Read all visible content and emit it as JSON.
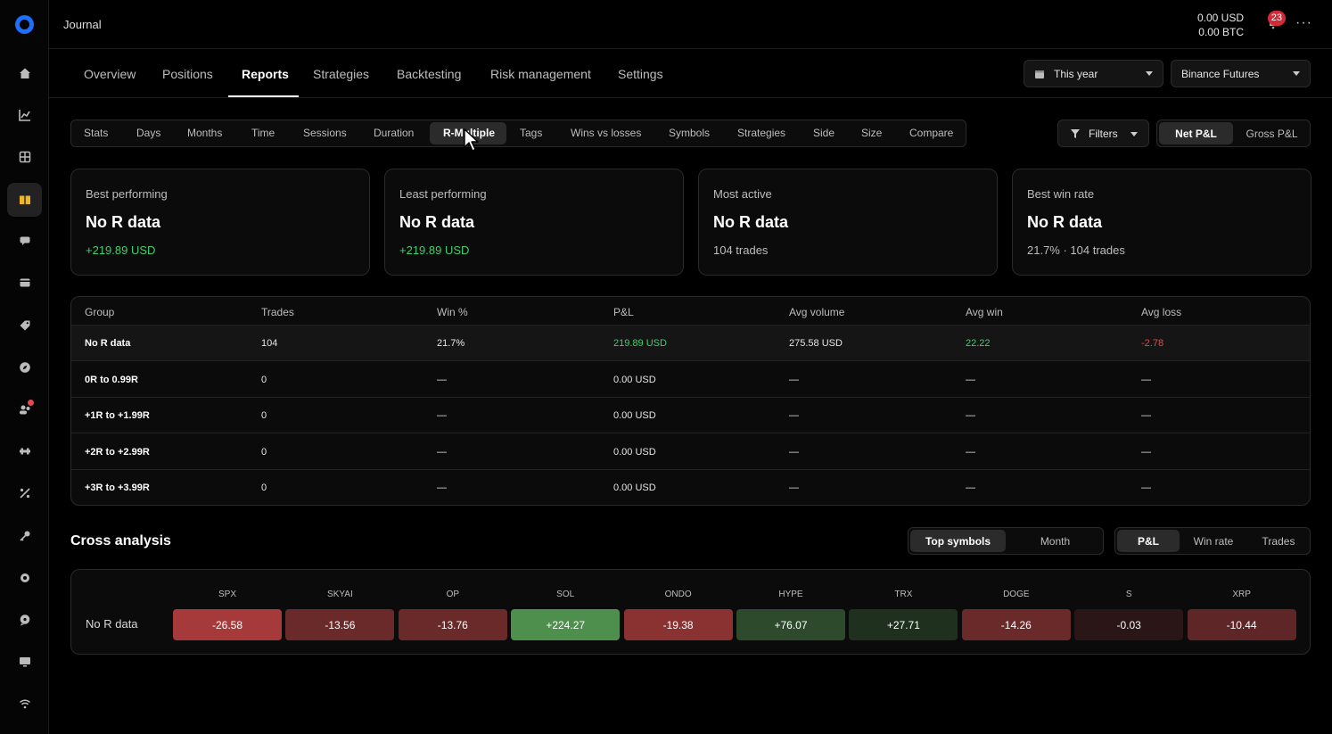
{
  "app": {
    "title": "Journal",
    "balance_usd": "0.00 USD",
    "balance_btc": "0.00 BTC",
    "notifications": "23",
    "more": "···"
  },
  "sidebar": {
    "icons": [
      "home-icon",
      "chart-icon",
      "grid-icon",
      "journal-icon",
      "chat-icon",
      "wallet-icon",
      "tag-icon",
      "compass-icon",
      "community-icon",
      "tools-icon",
      "percent-icon",
      "key-icon",
      "settings-icon",
      "support-icon",
      "monitor-icon",
      "wifi-icon"
    ],
    "active_index": 3
  },
  "nav": {
    "tabs": [
      "Overview",
      "Positions",
      "Reports",
      "Strategies",
      "Backtesting",
      "Risk management",
      "Settings"
    ],
    "active": "Reports",
    "period": "This year",
    "exchange": "Binance Futures"
  },
  "report_tabs": {
    "items": [
      "Stats",
      "Days",
      "Months",
      "Time",
      "Sessions",
      "Duration",
      "R-Multiple",
      "Tags",
      "Wins vs losses",
      "Symbols",
      "Strategies",
      "Side",
      "Size",
      "Compare"
    ],
    "active": "R-Multiple"
  },
  "controls": {
    "filters": "Filters",
    "pnl_modes": [
      "Net P&L",
      "Gross P&L"
    ],
    "pnl_active": "Net P&L"
  },
  "cards": [
    {
      "label": "Best performing",
      "value": "No R data",
      "sub": "+219.89 USD"
    },
    {
      "label": "Least performing",
      "value": "No R data",
      "sub": "+219.89 USD"
    },
    {
      "label": "Most active",
      "value": "No R data",
      "sub": "104 trades"
    },
    {
      "label": "Best win rate",
      "value": "No R data",
      "sub": "21.7% · 104 trades"
    }
  ],
  "table": {
    "headers": [
      "Group",
      "Trades",
      "Win %",
      "P&L",
      "Avg volume",
      "Avg win",
      "Avg loss"
    ],
    "rows": [
      {
        "group": "No R data",
        "trades": "104",
        "win": "21.7%",
        "pnl": "219.89 USD",
        "volume": "275.58 USD",
        "avg_win": "22.22",
        "avg_loss": "-2.78"
      },
      {
        "group": "0R to 0.99R",
        "trades": "0",
        "win": "—",
        "pnl": "0.00 USD",
        "volume": "—",
        "avg_win": "—",
        "avg_loss": "—"
      },
      {
        "group": "+1R to +1.99R",
        "trades": "0",
        "win": "—",
        "pnl": "0.00 USD",
        "volume": "—",
        "avg_win": "—",
        "avg_loss": "—"
      },
      {
        "group": "+2R to +2.99R",
        "trades": "0",
        "win": "—",
        "pnl": "0.00 USD",
        "volume": "—",
        "avg_win": "—",
        "avg_loss": "—"
      },
      {
        "group": "+3R to +3.99R",
        "trades": "0",
        "win": "—",
        "pnl": "0.00 USD",
        "volume": "—",
        "avg_win": "—",
        "avg_loss": "—"
      }
    ]
  },
  "cross": {
    "title": "Cross analysis",
    "dims": [
      "Top symbols",
      "Month"
    ],
    "dim_active": "Top symbols",
    "metrics": [
      "P&L",
      "Win rate",
      "Trades"
    ],
    "metric_active": "P&L",
    "row_label": "No R data",
    "symbols": [
      "SPX",
      "SKYAI",
      "OP",
      "SOL",
      "ONDO",
      "HYPE",
      "TRX",
      "DOGE",
      "S",
      "XRP"
    ],
    "values": [
      "-26.58",
      "-13.56",
      "-13.76",
      "+224.27",
      "-19.38",
      "+76.07",
      "+27.71",
      "-14.26",
      "-0.03",
      "-10.44"
    ],
    "colors": [
      "#a63a3a",
      "#6b2a2a",
      "#6b2a2a",
      "#4e8f4e",
      "#8a3232",
      "#2d4a2d",
      "#1f301f",
      "#6b2a2a",
      "#2a1616",
      "#5e2626"
    ]
  },
  "colors": {
    "accent": "#1f6fff",
    "positive": "#3ecf6e",
    "negative": "#e5484d",
    "badge": "#d42a38"
  }
}
